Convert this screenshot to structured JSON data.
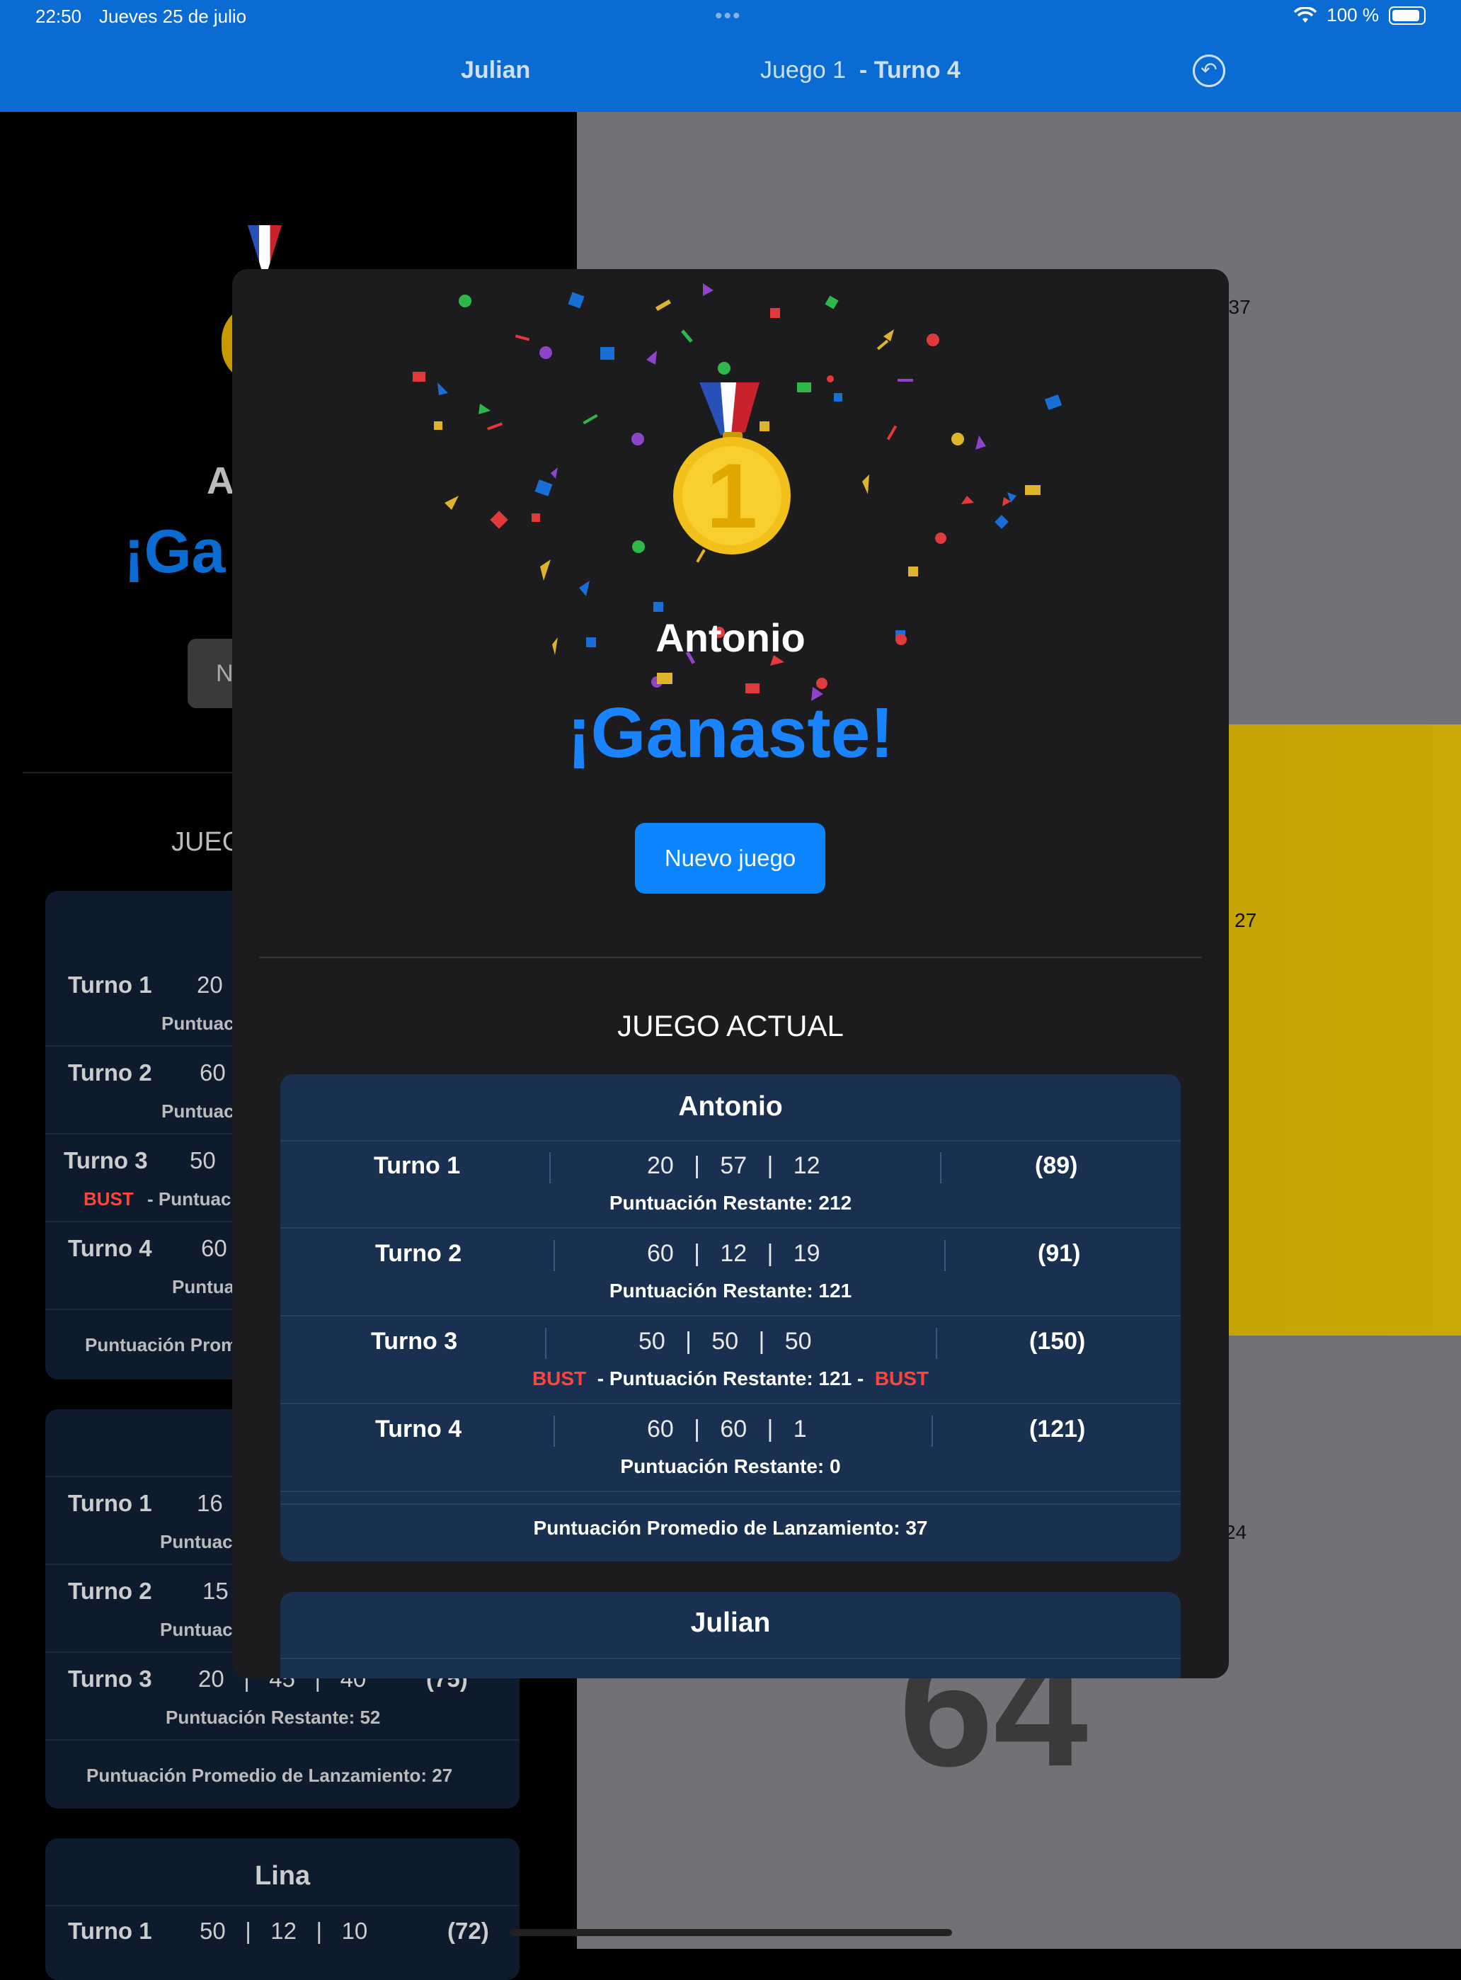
{
  "status": {
    "time": "22:50",
    "date": "Jueves 25 de julio",
    "battery": "100 %"
  },
  "nav": {
    "player": "Julian",
    "game": "Juego 1",
    "turn": "- Turno 4"
  },
  "background": {
    "right_labels": [
      ": 37",
      "27",
      "24"
    ],
    "big_number": "64",
    "letter_a": "A",
    "ganaste_partial": "¡Ga",
    "button_partial": "N",
    "section_partial": "JUEG",
    "cards": [
      {
        "rows": [
          {
            "turn": "Turno 1",
            "throws": "20",
            "sub": "Puntuac"
          },
          {
            "turn": "Turno 2",
            "throws": "60",
            "sub": "Puntuac"
          },
          {
            "turn": "Turno 3",
            "throws": "50",
            "bust": "BUST",
            "sub": "- Puntuac"
          },
          {
            "turn": "Turno 4",
            "throws": "60",
            "sub": "Puntua"
          }
        ],
        "avg": "Puntuación Prom"
      },
      {
        "rows": [
          {
            "turn": "Turno 1",
            "throws": "16",
            "sub": "Puntuac"
          },
          {
            "turn": "Turno 2",
            "throws": "15",
            "sub": "Puntuac"
          },
          {
            "turn": "Turno 3",
            "throws": "20   |   45   |   40",
            "total": "(75)",
            "sub": "Puntuación Restante: 52"
          }
        ],
        "avg": "Puntuación Promedio de Lanzamiento: 27"
      },
      {
        "name": "Lina",
        "rows": [
          {
            "turn": "Turno 1",
            "throws": "50   |   12   |   10",
            "total": "(72)"
          }
        ]
      }
    ]
  },
  "modal": {
    "winner": "Antonio",
    "headline": "¡Ganaste!",
    "new_game_button": "Nuevo juego",
    "section_title": "JUEGO ACTUAL",
    "players": [
      {
        "name": "Antonio",
        "turns": [
          {
            "label": "Turno 1",
            "throws": [
              "20",
              "57",
              "12"
            ],
            "total": "(89)",
            "remaining": "Puntuación Restante: 212"
          },
          {
            "label": "Turno 2",
            "throws": [
              "60",
              "12",
              "19"
            ],
            "total": "(91)",
            "remaining": "Puntuación Restante: 121"
          },
          {
            "label": "Turno 3",
            "throws": [
              "50",
              "50",
              "50"
            ],
            "total": "(150)",
            "bust": "BUST",
            "remaining": "- Puntuación Restante: 121 -",
            "bust2": "BUST"
          },
          {
            "label": "Turno 4",
            "throws": [
              "60",
              "60",
              "1"
            ],
            "total": "(121)",
            "remaining": "Puntuación Restante: 0"
          }
        ],
        "average": "Puntuación Promedio de Lanzamiento: 37"
      },
      {
        "name": "Julian"
      }
    ]
  },
  "colors": {
    "accent": "#0a84ff",
    "nav_bar": "#0a6bd2",
    "card": "#193050",
    "bust": "#ff453a"
  },
  "icons": [
    "wifi-icon",
    "battery-icon",
    "undo-icon",
    "medal-icon",
    "confetti"
  ]
}
